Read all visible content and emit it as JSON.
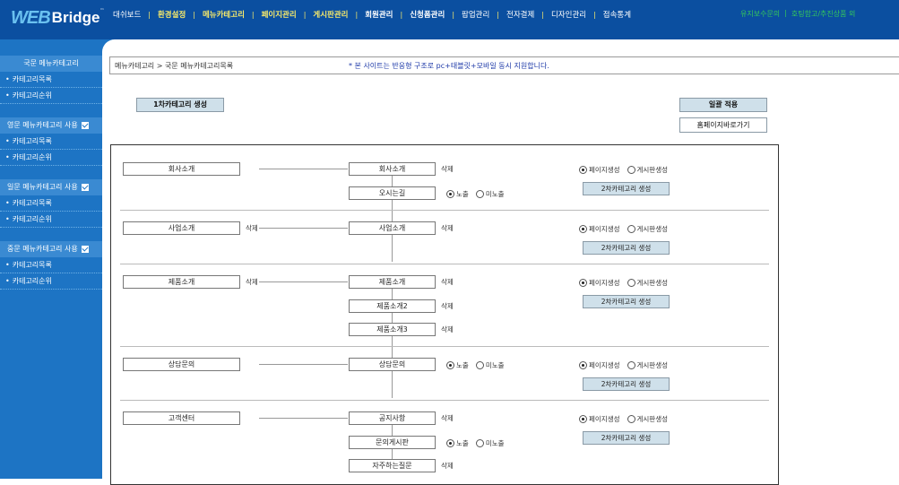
{
  "logo": {
    "mark": "WEB",
    "word": "Bridge",
    "tm": "™"
  },
  "nav": {
    "items": [
      {
        "label": "대쉬보드",
        "style": "normal"
      },
      {
        "label": "환경설정",
        "style": "hl"
      },
      {
        "label": "메뉴카테고리",
        "style": "hl"
      },
      {
        "label": "페이지관리",
        "style": "hl"
      },
      {
        "label": "게시판관리",
        "style": "hl"
      },
      {
        "label": "회원관리",
        "style": "bold"
      },
      {
        "label": "신청폼관리",
        "style": "bold"
      },
      {
        "label": "팝업관리",
        "style": "normal"
      },
      {
        "label": "전자결제",
        "style": "normal"
      },
      {
        "label": "디자인관리",
        "style": "normal"
      },
      {
        "label": "접속통계",
        "style": "normal"
      }
    ],
    "right_items": [
      "유지보수문의",
      "호팅함고/추진상품 외"
    ],
    "accent": "#f6e96a",
    "right_color": "#35c95a",
    "bg": "#0b4fa0"
  },
  "sidebar": {
    "sections": [
      {
        "title": "국문 메뉴카테고리",
        "checkbox": false,
        "items": [
          "카테고리목록",
          "카테고리순위"
        ]
      },
      {
        "title": "영문 메뉴카테고리 사용",
        "checkbox": true,
        "items": [
          "카테고리목록",
          "카테고리순위"
        ]
      },
      {
        "title": "일문 메뉴카테고리 사용",
        "checkbox": true,
        "items": [
          "카테고리목록",
          "카테고리순위"
        ]
      },
      {
        "title": "중문 메뉴카테고리 사용",
        "checkbox": true,
        "items": [
          "카테고리목록",
          "카테고리순위"
        ]
      }
    ],
    "bullet": "•"
  },
  "breadcrumb": "메뉴카테고리 > 국문 메뉴카테고리목록",
  "notice": "* 본 사이트는 반응형 구조로 pc+태블릿+모바일 동시 지원합니다.",
  "buttons": {
    "create_first": "1차카테고리 생성",
    "apply_all": "일괄 적용",
    "home_shortcut": "홈페이지바로가기",
    "create_second": "2차카테고리 생성"
  },
  "labels": {
    "delete": "삭제",
    "expose": "노출",
    "hide": "미노출",
    "page_create": "페이지생성",
    "board_create": "게시판생성"
  },
  "categories": [
    {
      "name": "회사소개",
      "first_delete": false,
      "children": [
        {
          "name": "회사소개",
          "delete": true,
          "visibility": false
        },
        {
          "name": "오시는길",
          "delete": false,
          "visibility": true
        }
      ]
    },
    {
      "name": "사업소개",
      "first_delete": true,
      "children": [
        {
          "name": "사업소개",
          "delete": true,
          "visibility": false
        }
      ]
    },
    {
      "name": "제품소개",
      "first_delete": true,
      "children": [
        {
          "name": "제품소개",
          "delete": true,
          "visibility": false
        },
        {
          "name": "제품소개2",
          "delete": true,
          "visibility": false
        },
        {
          "name": "제품소개3",
          "delete": true,
          "visibility": false
        }
      ]
    },
    {
      "name": "상담문의",
      "first_delete": false,
      "children": [
        {
          "name": "상담문의",
          "delete": false,
          "visibility": true
        }
      ]
    },
    {
      "name": "고객센터",
      "first_delete": false,
      "children": [
        {
          "name": "공지사항",
          "delete": true,
          "visibility": false
        },
        {
          "name": "문의게시판",
          "delete": false,
          "visibility": true
        },
        {
          "name": "자주하는질문",
          "delete": true,
          "visibility": false
        }
      ]
    }
  ]
}
